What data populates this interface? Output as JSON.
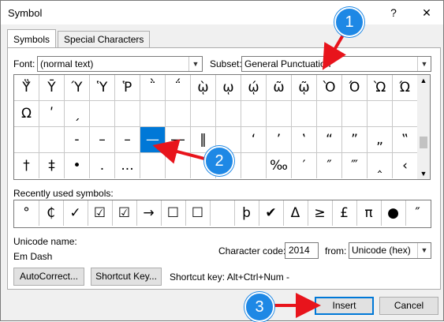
{
  "window": {
    "title": "Symbol",
    "help_glyph": "?",
    "close_glyph": "✕"
  },
  "tabs": [
    {
      "label": "Symbols",
      "active": true
    },
    {
      "label": "Special Characters",
      "active": false
    }
  ],
  "font": {
    "label": "Font:",
    "value": "(normal text)"
  },
  "subset": {
    "label": "Subset:",
    "value": "General Punctuation"
  },
  "symbol_grid": {
    "selected": "—",
    "rows": [
      [
        "Ϋ̌",
        "Ῡ",
        "Ύ",
        "Ὑ",
        "Ῥ",
        "῭",
        "΅",
        "ῲ",
        "ῳ",
        "ῴ",
        "ῶ",
        "ῷ",
        "Ὸ",
        "Ό",
        "Ὼ",
        "Ώ"
      ],
      [
        "Ω",
        "ʹ",
        "ˏ",
        "",
        "",
        "",
        "",
        "",
        "",
        "",
        "",
        "",
        "",
        "",
        "",
        ""
      ],
      [
        "",
        "",
        "-",
        "–",
        "–",
        "—",
        "―",
        "‖",
        "",
        "‘",
        "’",
        "‛",
        "“",
        "”",
        "„",
        "‟"
      ],
      [
        "†",
        "‡",
        "•",
        ".",
        "...",
        "",
        "",
        "",
        "",
        "",
        "‰",
        "′",
        "″",
        "‴",
        "‸",
        "‹"
      ]
    ]
  },
  "recent": {
    "label": "Recently used symbols:",
    "symbols": [
      "°",
      "₵",
      "✓",
      "☑",
      "☑",
      "→",
      "☐",
      "☐",
      "",
      "þ",
      "✔",
      "Δ",
      "≥",
      "£",
      "π",
      "●",
      "″"
    ]
  },
  "unicode": {
    "name_label": "Unicode name:",
    "name_value": "Em Dash"
  },
  "char_code": {
    "label": "Character code:",
    "value": "2014"
  },
  "from": {
    "label": "from:",
    "value": "Unicode (hex)"
  },
  "buttons": {
    "autocorrect": "AutoCorrect...",
    "shortcut_key": "Shortcut Key...",
    "insert": "Insert",
    "cancel": "Cancel"
  },
  "shortcut_info": "Shortcut key: Alt+Ctrl+Num -",
  "annotations": [
    "1",
    "2",
    "3"
  ],
  "colors": {
    "accent": "#0078d7",
    "badge": "#1e88e5",
    "arrow": "#e8141c"
  }
}
